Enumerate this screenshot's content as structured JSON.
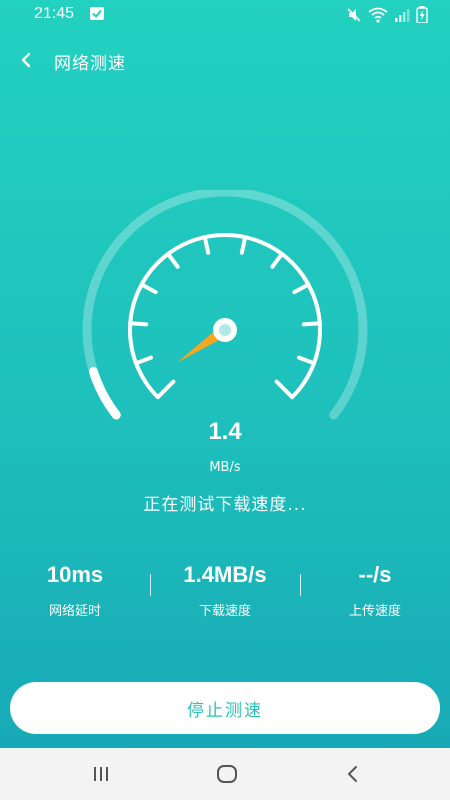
{
  "status_bar": {
    "time": "21:45",
    "icons": [
      "notification-check-icon",
      "mute-icon",
      "wifi-icon",
      "signal-icon",
      "battery-charging-icon"
    ]
  },
  "header": {
    "title": "网络测速",
    "back_icon": "chevron-left-icon"
  },
  "gauge": {
    "needle_fraction": 0.04,
    "progress_fraction": 0.08,
    "accent_needle": "#f5a623"
  },
  "speed": {
    "value": "1.4",
    "unit": "MB/s",
    "status": "正在测试下载速度..."
  },
  "stats": [
    {
      "value": "10ms",
      "label": "网络延时"
    },
    {
      "value": "1.4MB/s",
      "label": "下载速度"
    },
    {
      "value": "--/s",
      "label": "上传速度"
    }
  ],
  "actions": {
    "stop_label": "停止测速"
  },
  "nav": {
    "recent_icon": "recent-apps-icon",
    "home_icon": "home-icon",
    "back_icon": "back-icon"
  },
  "colors": {
    "gradient_top": "#23d1c0",
    "gradient_bottom": "#17aab6",
    "button_text": "#2ac3b8"
  }
}
